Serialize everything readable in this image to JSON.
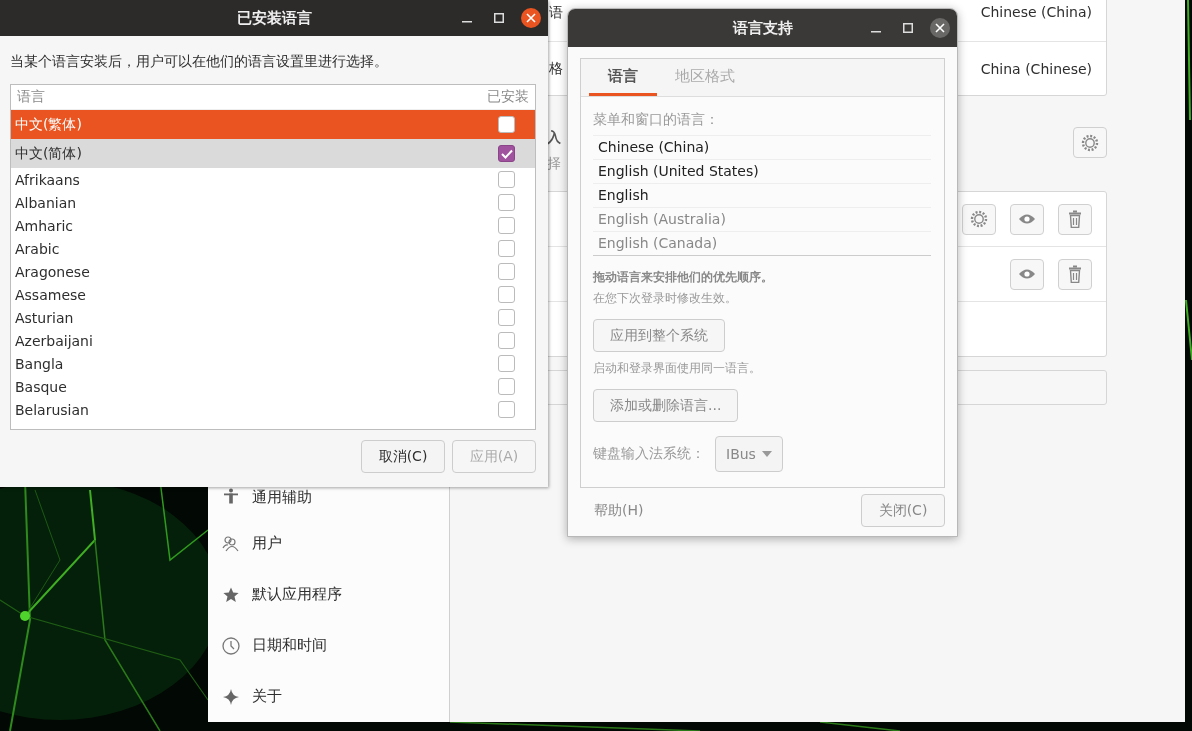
{
  "settings_window": {
    "language_rows": [
      {
        "label": "语",
        "value": "Chinese (China)"
      },
      {
        "label": "格",
        "value": "China (Chinese)"
      }
    ],
    "input_sources": {
      "heading": "入",
      "hint": "择",
      "rows": [
        {
          "has_settings": true
        },
        {
          "has_settings": false
        }
      ]
    },
    "sidebar": {
      "items": [
        {
          "label": "通用辅助",
          "kind": "accessibility"
        },
        {
          "label": "用户",
          "kind": "users"
        },
        {
          "label": "默认应用程序",
          "kind": "default-apps"
        },
        {
          "label": "日期和时间",
          "kind": "datetime"
        },
        {
          "label": "关于",
          "kind": "about"
        }
      ]
    }
  },
  "installed_languages_dialog": {
    "title": "已安装语言",
    "focused": true,
    "description": "当某个语言安装后，用户可以在他们的语言设置里进行选择。",
    "columns": [
      "语言",
      "已安装"
    ],
    "rows": [
      {
        "name": "中文(繁体)",
        "installed": false,
        "selected": true,
        "hovered": false
      },
      {
        "name": "中文(简体)",
        "installed": true,
        "selected": false,
        "hovered": true
      },
      {
        "name": "Afrikaans",
        "installed": false,
        "selected": false,
        "hovered": false
      },
      {
        "name": "Albanian",
        "installed": false,
        "selected": false,
        "hovered": false
      },
      {
        "name": "Amharic",
        "installed": false,
        "selected": false,
        "hovered": false
      },
      {
        "name": "Arabic",
        "installed": false,
        "selected": false,
        "hovered": false
      },
      {
        "name": "Aragonese",
        "installed": false,
        "selected": false,
        "hovered": false
      },
      {
        "name": "Assamese",
        "installed": false,
        "selected": false,
        "hovered": false
      },
      {
        "name": "Asturian",
        "installed": false,
        "selected": false,
        "hovered": false
      },
      {
        "name": "Azerbaijani",
        "installed": false,
        "selected": false,
        "hovered": false
      },
      {
        "name": "Bangla",
        "installed": false,
        "selected": false,
        "hovered": false
      },
      {
        "name": "Basque",
        "installed": false,
        "selected": false,
        "hovered": false
      },
      {
        "name": "Belarusian",
        "installed": false,
        "selected": false,
        "hovered": false
      }
    ],
    "buttons": [
      {
        "label": "取消(C)",
        "disabled": false
      },
      {
        "label": "应用(A)",
        "disabled": true
      }
    ]
  },
  "language_support_dialog": {
    "title": "语言支持",
    "focused": false,
    "tabs": [
      {
        "label": "语言",
        "selected": true
      },
      {
        "label": "地区格式",
        "selected": false
      }
    ],
    "list_label": "菜单和窗口的语言：",
    "languages": [
      {
        "name": "Chinese (China)",
        "dimmed": false
      },
      {
        "name": "English (United States)",
        "dimmed": false
      },
      {
        "name": "English",
        "dimmed": false
      },
      {
        "name": "English (Australia)",
        "dimmed": true
      },
      {
        "name": "English (Canada)",
        "dimmed": true
      }
    ],
    "drag_hint": "拖动语言来安排他们的优先顺序。",
    "login_note": "在您下次登录时修改生效。",
    "apply_button": "应用到整个系统",
    "apply_note": "启动和登录界面使用同一语言。",
    "add_remove_button": "添加或删除语言...",
    "im_label": "键盘输入法系统：",
    "im_value": "IBus",
    "help_button": "帮助(H)",
    "close_button": "关闭(C)"
  }
}
